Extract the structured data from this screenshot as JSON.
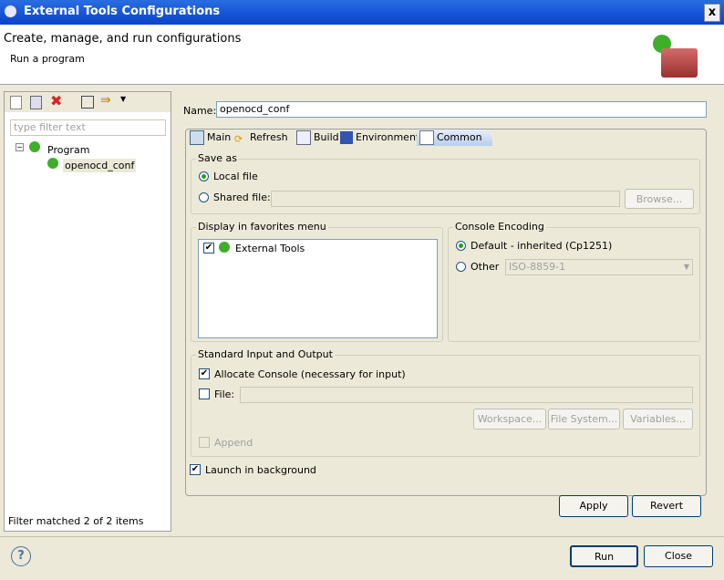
{
  "window": {
    "title": "External Tools Configurations",
    "close": "x"
  },
  "header": {
    "title": "Create, manage, and run configurations",
    "subtitle": "Run a program"
  },
  "left": {
    "filter_placeholder": "type filter text",
    "tree": [
      {
        "label": "Program"
      },
      {
        "label": "openocd_conf"
      }
    ],
    "status": "Filter matched 2 of 2 items"
  },
  "name": {
    "label": "Name:",
    "value": "openocd_conf"
  },
  "tabs": [
    "Main",
    "Refresh",
    "Build",
    "Environment",
    "Common"
  ],
  "save_as": {
    "title": "Save as",
    "local": "Local file",
    "shared": "Shared file:",
    "browse": "Browse..."
  },
  "favorites": {
    "title": "Display in favorites menu",
    "items": [
      "External Tools"
    ]
  },
  "encoding": {
    "title": "Console Encoding",
    "default": "Default - inherited (Cp1251)",
    "other": "Other",
    "other_value": "ISO-8859-1"
  },
  "stdio": {
    "title": "Standard Input and Output",
    "allocate": "Allocate Console (necessary for input)",
    "file": "File:",
    "workspace": "Workspace...",
    "filesystem": "File System...",
    "variables": "Variables...",
    "append": "Append"
  },
  "launch_bg": "Launch in background",
  "buttons": {
    "apply": "Apply",
    "revert": "Revert",
    "run": "Run",
    "close": "Close",
    "help": "?"
  }
}
